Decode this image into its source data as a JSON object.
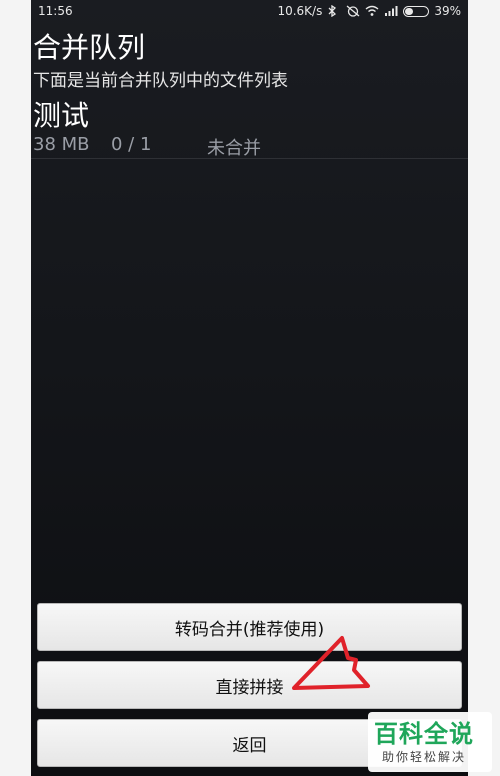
{
  "status_bar": {
    "time": "11:56",
    "network_speed": "10.6K/s",
    "battery_percent": "39%",
    "battery_level": 0.39,
    "icons": [
      "bluetooth-icon",
      "alarm-off-icon",
      "wifi-icon",
      "signal-icon",
      "battery-icon"
    ]
  },
  "header": {
    "title": "合并队列",
    "subtitle": "下面是当前合并队列中的文件列表"
  },
  "queue": [
    {
      "name": "测试",
      "size": "38 MB",
      "progress": "0 / 1",
      "status": "未合并"
    }
  ],
  "buttons": {
    "transcode_merge": "转码合并(推荐使用)",
    "direct_concat": "直接拼接",
    "back": "返回"
  },
  "watermark": {
    "main": "百科全说",
    "sub": "助你轻松解决"
  },
  "colors": {
    "background": "#14161a",
    "button": "#eeeeee",
    "annotation": "#e0222a",
    "watermark_green": "#1fa65a"
  }
}
